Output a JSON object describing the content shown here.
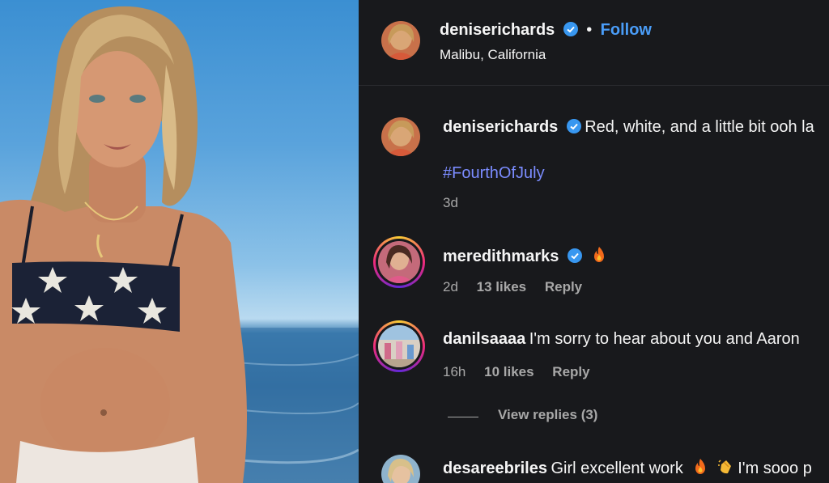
{
  "post": {
    "author": "deniserichards",
    "location": "Malibu, California",
    "follow_label": "Follow",
    "dot": "•"
  },
  "caption": {
    "author": "deniserichards",
    "text": "Red, white, and a little bit ooh la",
    "hashtag": "#FourthOfJuly",
    "time": "3d"
  },
  "comments": [
    {
      "author": "meredithmarks",
      "verified": true,
      "text": "",
      "emoji": [
        "fire-emoji"
      ],
      "time": "2d",
      "likes": "13 likes",
      "reply": "Reply"
    },
    {
      "author": "danilsaaaa",
      "verified": false,
      "text": "I'm sorry to hear about you and Aaron",
      "time": "16h",
      "likes": "10 likes",
      "reply": "Reply",
      "view_replies": "View replies (3)"
    },
    {
      "author": "desareebriles",
      "verified": false,
      "text": "Girl excellent work",
      "text2": "I'm sooo p"
    }
  ],
  "colors": {
    "panel_bg": "#18191c",
    "link": "#7b8cff",
    "follow": "#4a9df8",
    "verified": "#3897f0",
    "muted": "#a8a8a8"
  }
}
